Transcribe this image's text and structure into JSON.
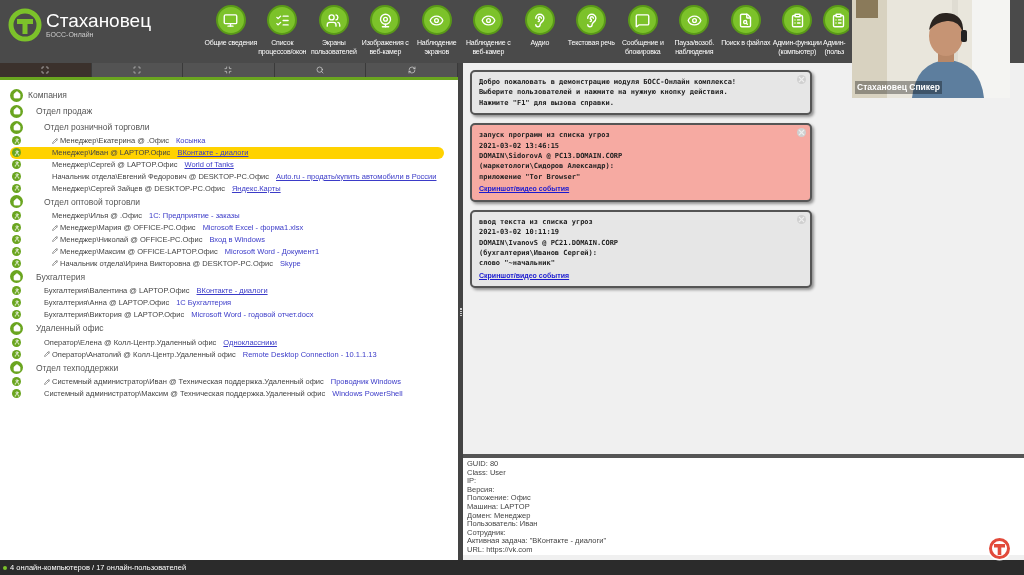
{
  "header": {
    "logo_title": "Стахановец",
    "logo_subtitle": "БОСС-Онлайн"
  },
  "toolbar": [
    {
      "kind": "monitor",
      "lines": [
        "Общие сведения"
      ]
    },
    {
      "kind": "list",
      "lines": [
        "Список",
        "процессов/окон"
      ]
    },
    {
      "kind": "screens",
      "lines": [
        "Экраны",
        "пользователей"
      ]
    },
    {
      "kind": "webcam",
      "lines": [
        "Изображения с",
        "веб-камер"
      ]
    },
    {
      "kind": "eye",
      "lines": [
        "Наблюдение",
        "экранов"
      ]
    },
    {
      "kind": "eye",
      "lines": [
        "Наблюдение с",
        "веб-камер"
      ]
    },
    {
      "kind": "ear",
      "lines": [
        "Аудио"
      ]
    },
    {
      "kind": "ear",
      "lines": [
        "Текстовая речь"
      ]
    },
    {
      "kind": "message",
      "lines": [
        "Сообщение и",
        "блокировка"
      ]
    },
    {
      "kind": "eye",
      "lines": [
        "Пауза/возоб.",
        "наблюдения"
      ]
    },
    {
      "kind": "search",
      "lines": [
        "Поиск в файлах"
      ]
    },
    {
      "kind": "clipboard",
      "lines": [
        "Админ-функции",
        "(компьютер)"
      ]
    },
    {
      "kind": "clipboard",
      "lines": [
        "Админ-",
        "(польз"
      ]
    }
  ],
  "webcam": {
    "label": "Стахановец Спикер"
  },
  "tabs": [
    {
      "kind": "expand",
      "selected": true
    },
    {
      "kind": "collapse",
      "selected": false
    },
    {
      "kind": "shrink",
      "selected": false
    },
    {
      "kind": "search",
      "selected": false
    },
    {
      "kind": "refresh",
      "selected": false
    }
  ],
  "tree": [
    {
      "kind": "group",
      "name": "Компания",
      "children": [
        {
          "kind": "group",
          "name": "Отдел продаж",
          "children": [
            {
              "kind": "group",
              "name": "Отдел розничной торговли",
              "children": [
                {
                  "kind": "user",
                  "name": "Менеджер\\Екатерина @ .Офис",
                  "task": "Косынка",
                  "web": false,
                  "pencil": true,
                  "selected": false
                },
                {
                  "kind": "user",
                  "name": "Менеджер\\Иван @ LAPTOP.Офис",
                  "task": "ВКонтакте - диалоги",
                  "web": true,
                  "pencil": false,
                  "selected": true
                },
                {
                  "kind": "user",
                  "name": "Менеджер\\Сергей @ LAPTOP.Офис",
                  "task": "World of Tanks",
                  "web": true,
                  "pencil": false,
                  "selected": false
                },
                {
                  "kind": "user",
                  "name": "Начальник отдела\\Евгений Федорович @ DESKTOP-PC.Офис",
                  "task": "Auto.ru - продать/купить автомобили в России",
                  "web": true,
                  "pencil": false,
                  "selected": false
                },
                {
                  "kind": "user",
                  "name": "Менеджер\\Сергей Зайцев @ DESKTOP-PC.Офис",
                  "task": "Яндекс.Карты",
                  "web": true,
                  "pencil": false,
                  "selected": false
                }
              ]
            },
            {
              "kind": "group",
              "name": "Отдел оптовой торговли",
              "children": [
                {
                  "kind": "user",
                  "name": "Менеджер\\Илья @ .Офис",
                  "task": "1С: Предприятие - заказы",
                  "web": false,
                  "pencil": false,
                  "selected": false
                },
                {
                  "kind": "user",
                  "name": "Менеджер\\Мария @ OFFICE-PC.Офис",
                  "task": "Microsoft Excel - форма1.xlsx",
                  "web": false,
                  "pencil": true,
                  "selected": false
                },
                {
                  "kind": "user",
                  "name": "Менеджер\\Николай @ OFFICE-PC.Офис",
                  "task": "Вход в Windows",
                  "web": false,
                  "pencil": true,
                  "selected": false
                },
                {
                  "kind": "user",
                  "name": "Менеджер\\Максим @ OFFICE-LAPTOP.Офис",
                  "task": "Microsoft Word - Документ1",
                  "web": false,
                  "pencil": true,
                  "selected": false
                },
                {
                  "kind": "user",
                  "name": "Начальник отдела\\Ирина Викторовна @ DESKTOP-PC.Офис",
                  "task": "Skype",
                  "web": false,
                  "pencil": true,
                  "selected": false
                }
              ]
            }
          ]
        },
        {
          "kind": "group",
          "name": "Бухгалтерия",
          "children": [
            {
              "kind": "user",
              "name": "Бухгалтерия\\Валентина @ LAPTOP.Офис",
              "task": "ВКонтакте - диалоги",
              "web": true,
              "pencil": false,
              "selected": false
            },
            {
              "kind": "user",
              "name": "Бухгалтерия\\Анна @ LAPTOP.Офис",
              "task": "1С Бухгалтерия",
              "web": false,
              "pencil": false,
              "selected": false
            },
            {
              "kind": "user",
              "name": "Бухгалтерия\\Виктория @ LAPTOP.Офис",
              "task": "Microsoft Word - годовой отчет.docx",
              "web": false,
              "pencil": false,
              "selected": false
            }
          ]
        },
        {
          "kind": "group",
          "name": "Удаленный офис",
          "children": [
            {
              "kind": "user",
              "name": "Оператор\\Елена @ Колл-Центр.Удаленный офис",
              "task": "Одноклассники",
              "web": true,
              "pencil": false,
              "selected": false
            },
            {
              "kind": "user",
              "name": "Оператор\\Анатолий @ Колл-Центр.Удаленный офис",
              "task": "Remote Desktop Connection - 10.1.1.13",
              "web": false,
              "pencil": true,
              "selected": false
            }
          ]
        },
        {
          "kind": "group",
          "name": "Отдел техподдержки",
          "children": [
            {
              "kind": "user",
              "name": "Системный администратор\\Иван @ Техническая поддержка.Удаленный офис",
              "task": "Проводник Windows",
              "web": false,
              "pencil": true,
              "selected": false
            },
            {
              "kind": "user",
              "name": "Системный администратор\\Максим @ Техническая поддержка.Удаленный офис",
              "task": "Windows PowerShell",
              "web": false,
              "pencil": false,
              "selected": false
            }
          ]
        }
      ]
    }
  ],
  "messages": [
    {
      "kind": "info",
      "lines": [
        "Добро пожаловать в демонстрацию модуля БОСС-Онлайн комплекса!",
        "Выберите пользователей и нажмите на нужную кнопку действия.",
        "Нажмите \"F1\" для вызова справки."
      ]
    },
    {
      "kind": "alert",
      "lines": [
        "запуск программ из списка угроз",
        "2021-03-02 13:46:15",
        "DOMAIN\\SidorovA @ PC13.DOMAIN.CORP",
        "(маркетологи\\Сидоров Александр):",
        "приложение \"Tor Browser\""
      ],
      "link": "Скриншот/видео события"
    },
    {
      "kind": "notice",
      "lines": [
        "ввод текста из списка угроз",
        "2021-03-02 10:11:19",
        "DOMAIN\\IvanovS @ PC21.DOMAIN.CORP",
        "(бухгалтерия\\Иванов Сергей):",
        "слово \"~начальник\""
      ],
      "link": "Скриншот/видео события"
    }
  ],
  "details": [
    "GUID: 80",
    "Class: User",
    "IP:",
    "Версия:",
    "Положение: Офис",
    "Машина: LAPTOP",
    "Домен: Менеджер",
    "Пользователь: Иван",
    "Сотрудник:",
    "Активная задача: \"ВКонтакте - диалоги\"",
    "URL: https://vk.com"
  ],
  "status_bar": {
    "text": "4 онлайн-компьютеров / 17 онлайн-пользователей"
  }
}
